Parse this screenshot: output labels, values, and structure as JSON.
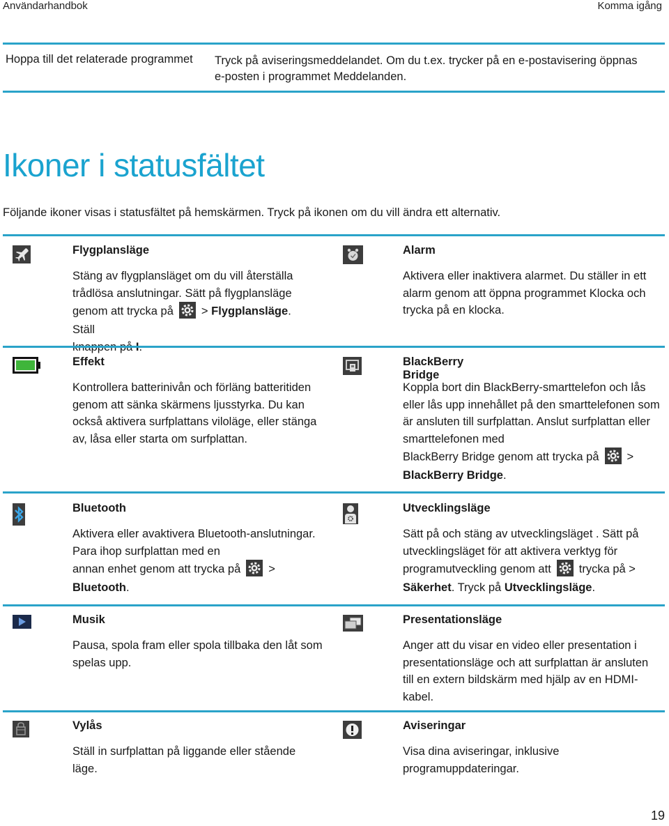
{
  "header": {
    "left": "Användarhandbok",
    "right": "Komma igång"
  },
  "top_table": {
    "label": "Hoppa till det relaterade programmet",
    "text": "Tryck på aviseringsmeddelandet. Om du t.ex. trycker på en e-postavisering öppnas e-posten i programmet Meddelanden."
  },
  "section": {
    "title": "Ikoner i statusfältet",
    "intro": "Följande ikoner visas i statusfältet på hemskärmen. Tryck på ikonen om du vill ändra ett alternativ."
  },
  "colors": {
    "accent": "#1aa3cf",
    "rule": "#2aa3c9",
    "icon_bg": "#3d3d3d",
    "battery_green": "#3fb53a",
    "music_bg": "#1b2a4a"
  },
  "items": {
    "flygplan": {
      "icon": "airplane-icon",
      "title": "Flygplansläge",
      "desc1": "Stäng av flygplansläget om du vill återställa trådlösa anslutningar. Sätt på flygplansläge",
      "desc2a": "genom att trycka på",
      "desc2b": "> ",
      "desc2c": "Flygplansläge",
      "desc2d": ". Ställ",
      "desc3a": "knappen på ",
      "desc3b": "I",
      "desc3c": "."
    },
    "alarm": {
      "icon": "alarm-clock-icon",
      "title": "Alarm",
      "desc": "Aktivera eller inaktivera alarmet. Du ställer in ett alarm genom att öppna programmet Klocka och trycka på en klocka."
    },
    "effekt": {
      "icon": "battery-icon",
      "title": "Effekt",
      "desc": "Kontrollera batterinivån och förläng batteritiden genom att sänka skärmens ljusstyrka. Du kan också aktivera surfplattans viloläge, eller stänga av, låsa eller starta om surfplattan."
    },
    "bridge": {
      "icon": "blackberry-bridge-icon",
      "title": "BlackBerry Bridge",
      "desc1": "Koppla bort din BlackBerry-smarttelefon och lås eller lås upp innehållet på den smarttelefonen som är ansluten till surfplattan. Anslut surfplattan eller smarttelefonen med",
      "desc2a": "BlackBerry Bridge genom att trycka på",
      "desc2b": ">",
      "desc3a": "BlackBerry Bridge",
      "desc3b": "."
    },
    "bluetooth": {
      "icon": "bluetooth-icon",
      "title": "Bluetooth",
      "desc1": "Aktivera eller avaktivera Bluetooth-anslutningar. Para ihop surfplattan med en",
      "desc2a": "annan enhet genom att trycka på",
      "desc2b": ">",
      "desc3a": "Bluetooth",
      "desc3b": "."
    },
    "utveckling": {
      "icon": "developer-mode-icon",
      "title": "Utvecklingsläge",
      "desc1": "Sätt på och stäng av utvecklingsläget . Sätt på utvecklingsläget för att aktivera verktyg för",
      "desc2a": "programutveckling genom att",
      "desc2b": "trycka på >",
      "desc3a": "Säkerhet",
      "desc3b": ". Tryck på ",
      "desc3c": "Utvecklingsläge",
      "desc3d": "."
    },
    "musik": {
      "icon": "play-icon",
      "title": "Musik",
      "desc": "Pausa, spola fram eller spola tillbaka den låt som spelas upp."
    },
    "presentation": {
      "icon": "presentation-mode-icon",
      "title": "Presentationsläge",
      "desc": "Anger att du visar en video eller presentation i presentationsläge och att surfplattan är ansluten till en extern bildskärm med hjälp av en HDMI-kabel."
    },
    "vylas": {
      "icon": "orientation-lock-icon",
      "title": "Vylås",
      "desc": "Ställ in surfplattan på liggande eller stående läge."
    },
    "aviseringar": {
      "icon": "notification-icon",
      "title": "Aviseringar",
      "desc": "Visa dina aviseringar, inklusive programuppdateringar."
    }
  },
  "page_number": "19"
}
